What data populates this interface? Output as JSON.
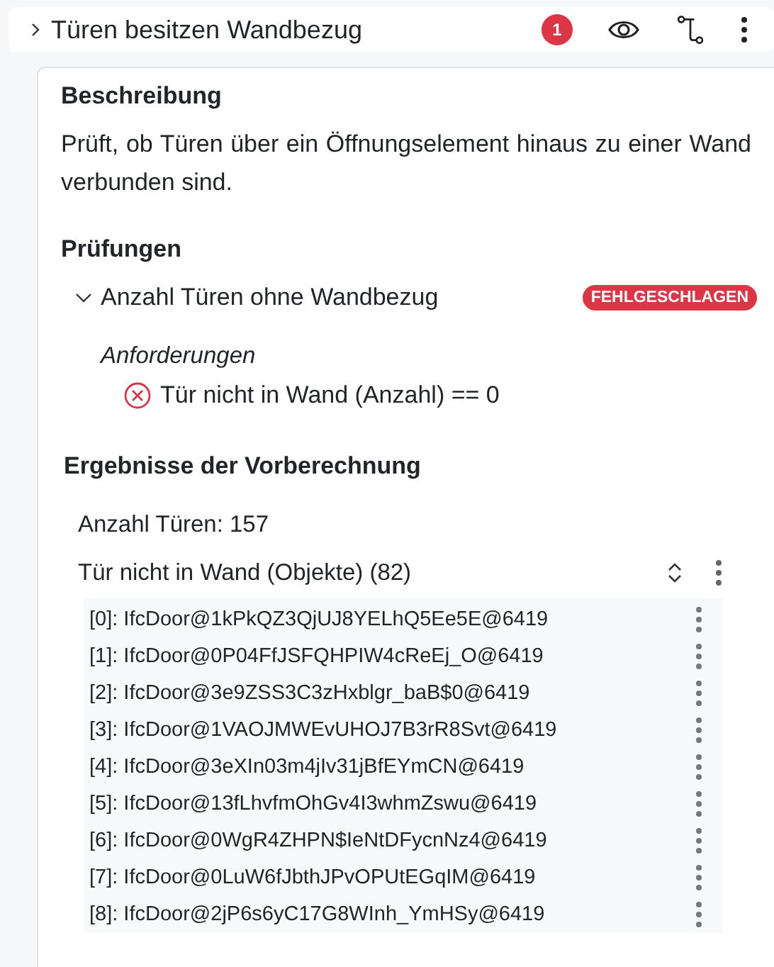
{
  "header": {
    "title": "Türen besitzen Wandbezug",
    "expanded": false,
    "badge": "1"
  },
  "description": {
    "heading": "Beschreibung",
    "text": "Prüft, ob Türen über ein Öffnungselement hinaus zu einer Wand verbunden sind."
  },
  "checks": {
    "heading": "Prüfungen",
    "items": [
      {
        "name": "Anzahl Türen ohne Wandbezug",
        "expanded": true,
        "passed": false,
        "status_label": "FEHLGESCHLAGEN",
        "requirements_heading": "Anforderungen",
        "requirements": [
          {
            "text": "Tür nicht in Wand (Anzahl) == 0",
            "passed": false
          }
        ]
      }
    ]
  },
  "precalc": {
    "heading": "Ergebnisse der Vorberechnung",
    "count_text": "Anzahl Türen: 157",
    "list_title": "Tür nicht in Wand (Objekte) (82)",
    "rows": [
      "[0]: IfcDoor@1kPkQZ3QjUJ8YELhQ5Ee5E@6419",
      "[1]: IfcDoor@0P04FfJSFQHPIW4cReEj_O@6419",
      "[2]: IfcDoor@3e9ZSS3C3zHxblgr_baB$0@6419",
      "[3]: IfcDoor@1VAOJMWEvUHOJ7B3rR8Svt@6419",
      "[4]: IfcDoor@3eXIn03m4jIv31jBfEYmCN@6419",
      "[5]: IfcDoor@13fLhvfmOhGv4I3whmZswu@6419",
      "[6]: IfcDoor@0WgR4ZHPN$IeNtDFycnNz4@6419",
      "[7]: IfcDoor@0LuW6fJbthJPvOPUtEGqIM@6419",
      "[8]: IfcDoor@2jP6s6yC17G8WInh_YmHSy@6419"
    ]
  }
}
